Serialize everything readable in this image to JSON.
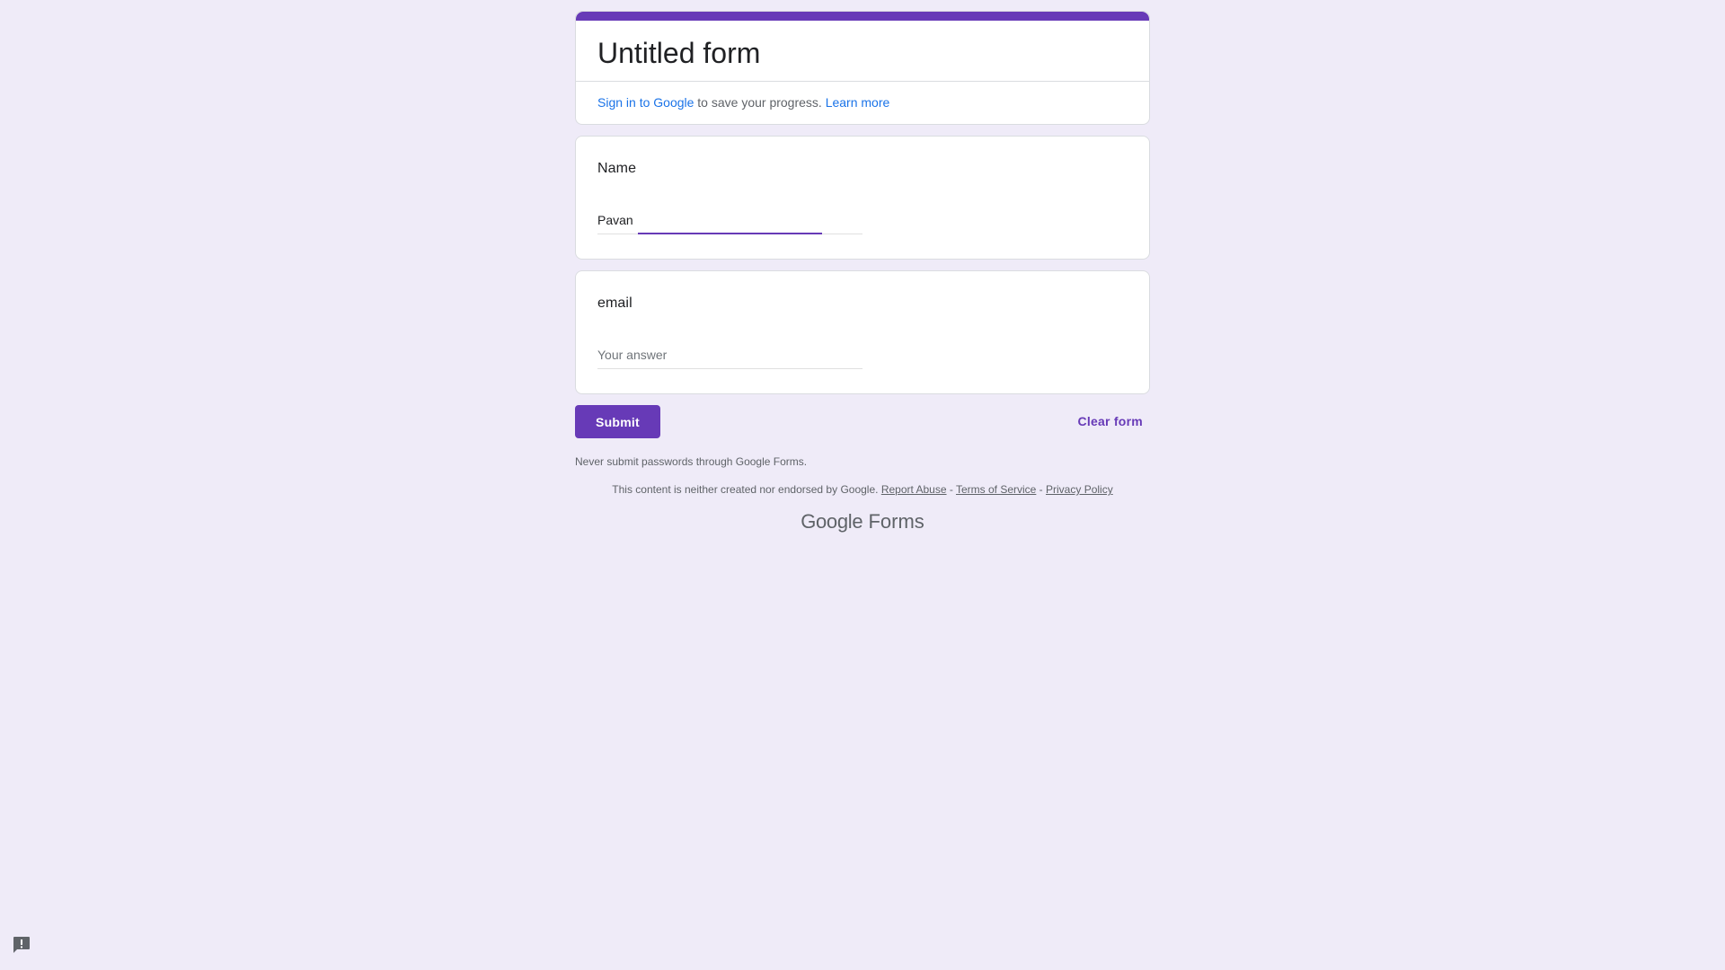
{
  "form": {
    "title": "Untitled form",
    "accent_color": "#673ab7",
    "background_color": "#efebf8"
  },
  "signin": {
    "link_label": "Sign in to Google",
    "middle_text": " to save your progress. ",
    "learn_more_label": "Learn more"
  },
  "questions": [
    {
      "label": "Name",
      "value": "Pavan",
      "placeholder": "Your answer",
      "focused": true
    },
    {
      "label": "email",
      "value": "",
      "placeholder": "Your answer",
      "focused": false
    }
  ],
  "actions": {
    "submit_label": "Submit",
    "clear_label": "Clear form"
  },
  "footer": {
    "warning": "Never submit passwords through Google Forms.",
    "disclaimer_text": "This content is neither created nor endorsed by Google. ",
    "report_abuse": "Report Abuse",
    "separator": " - ",
    "terms": "Terms of Service",
    "privacy": "Privacy Policy",
    "brand_google": "Google",
    "brand_forms": "Forms"
  },
  "icons": {
    "report": "report-problem-icon"
  }
}
